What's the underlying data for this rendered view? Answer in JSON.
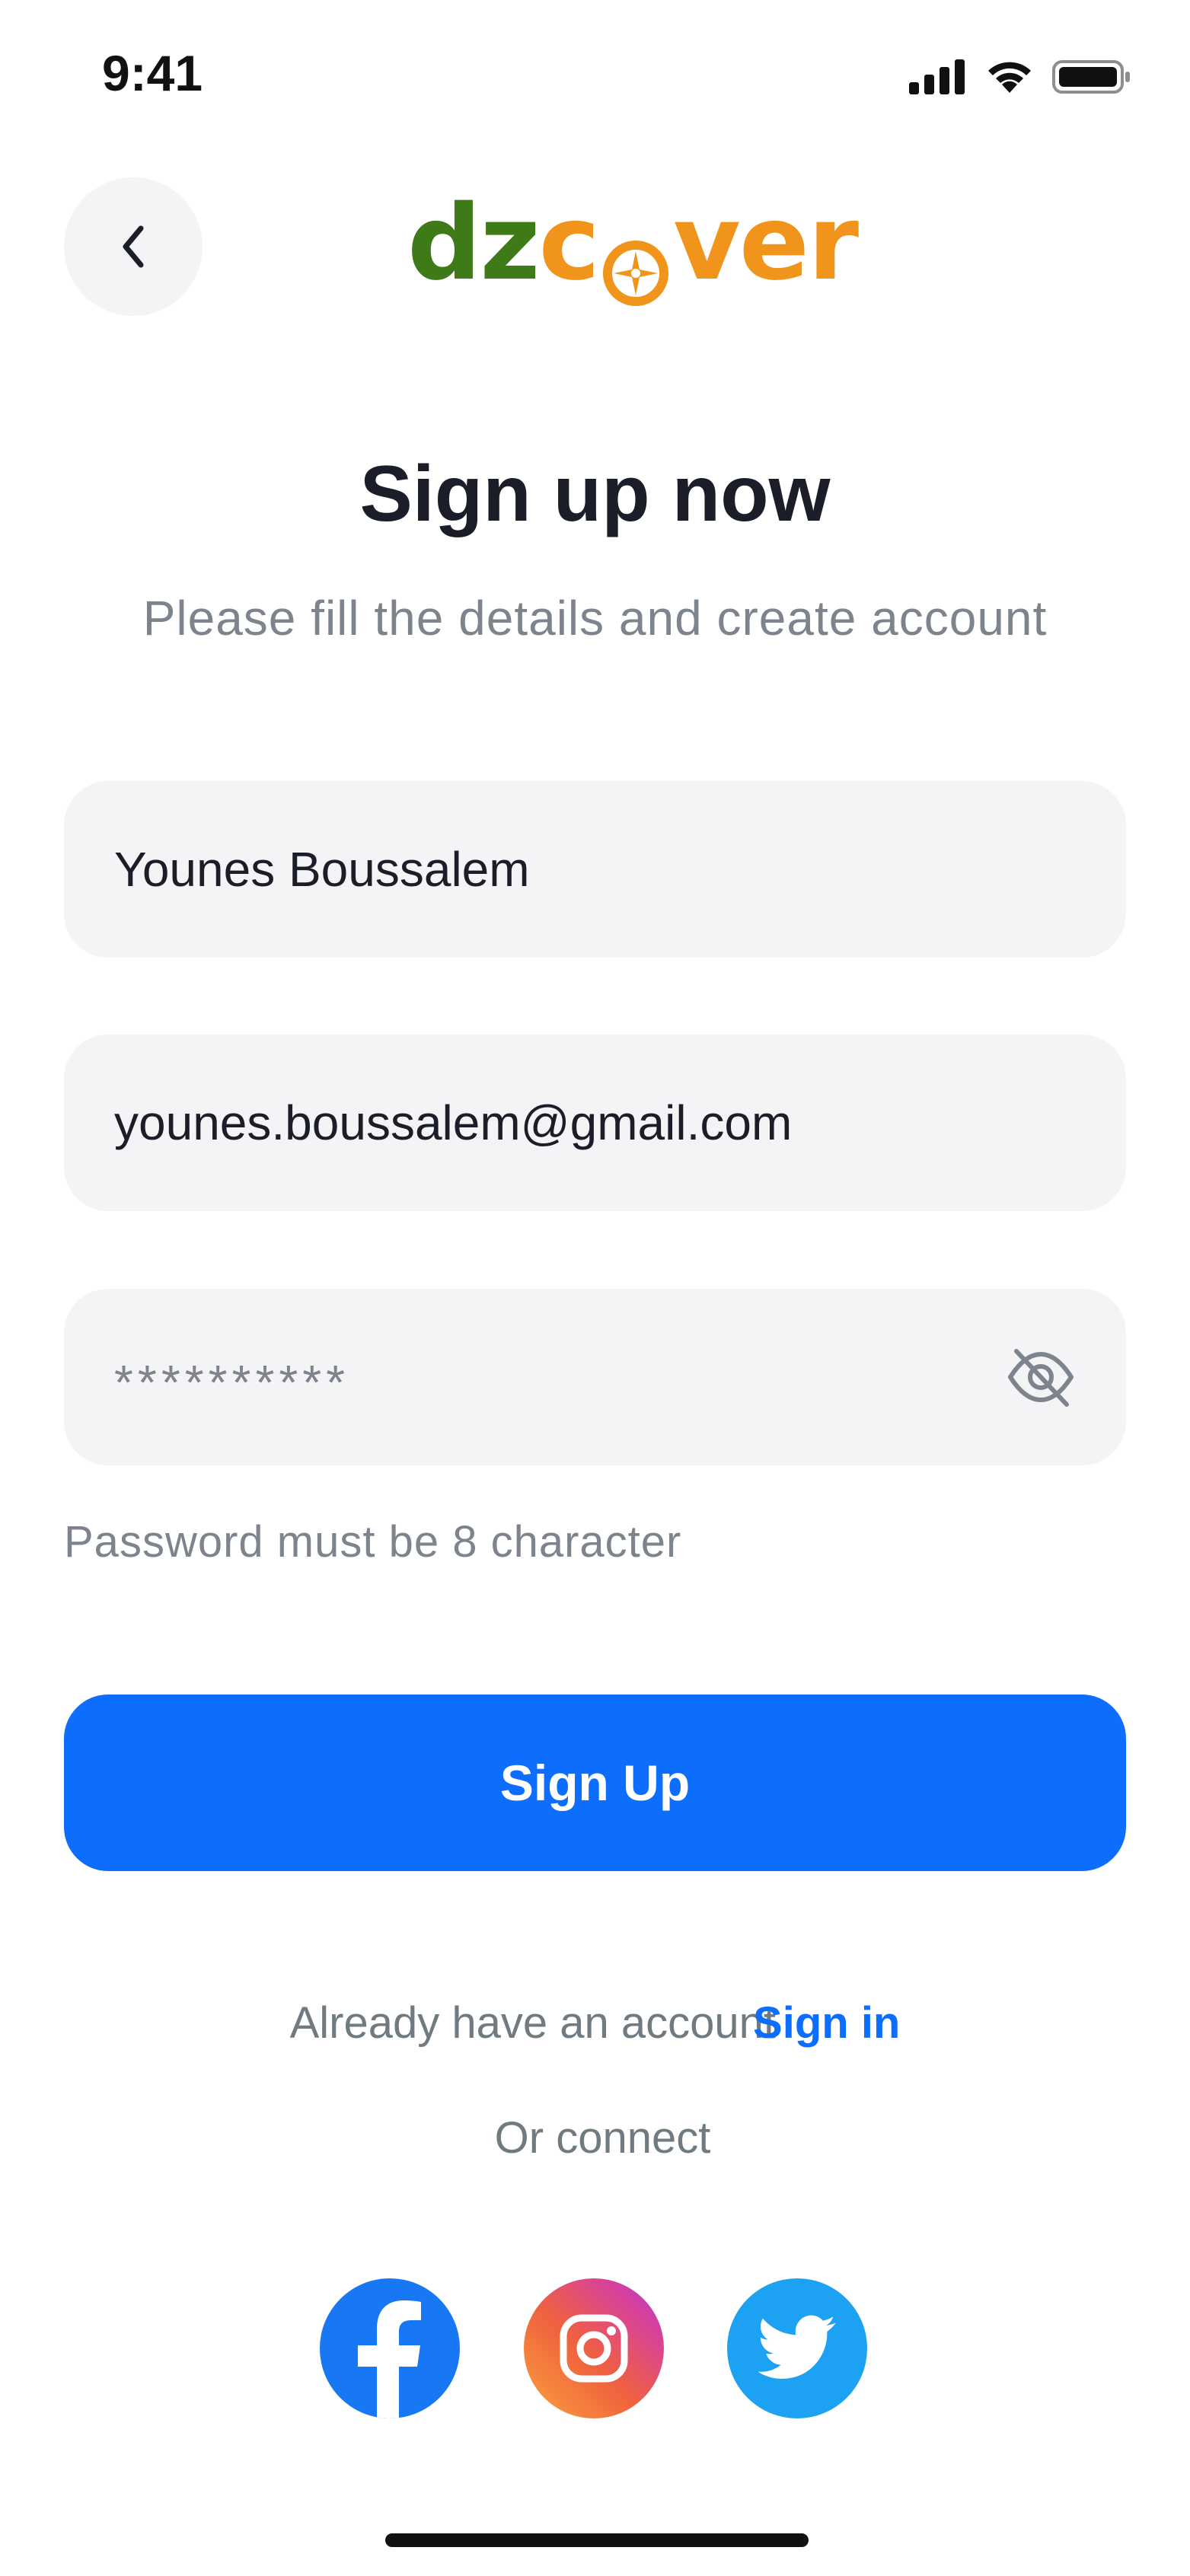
{
  "status_bar": {
    "time": "9:41"
  },
  "header": {
    "back_icon": "chevron-left-icon",
    "logo": {
      "part1": "dz",
      "part2": "c",
      "part3": "ver"
    }
  },
  "title": "Sign up now",
  "subtitle": "Please fill the details and create account",
  "form": {
    "name_value": "Younes Boussalem",
    "email_value": "younes.boussalem@gmail.com",
    "password_value": "**********",
    "password_icon": "eye-off-icon",
    "password_hint": "Password must be 8 character"
  },
  "signup_button": "Sign Up",
  "signin_prompt": {
    "text": "Already have an account",
    "link": "Sign in"
  },
  "or_connect": "Or connect",
  "social": [
    {
      "name": "facebook",
      "icon": "facebook-icon"
    },
    {
      "name": "instagram",
      "icon": "instagram-icon"
    },
    {
      "name": "twitter",
      "icon": "twitter-icon"
    }
  ],
  "colors": {
    "primary": "#0d6efd",
    "logo_green": "#3e7a17",
    "logo_orange": "#f1941b",
    "field_bg": "#f4f4f6",
    "muted_text": "#7d848d"
  }
}
